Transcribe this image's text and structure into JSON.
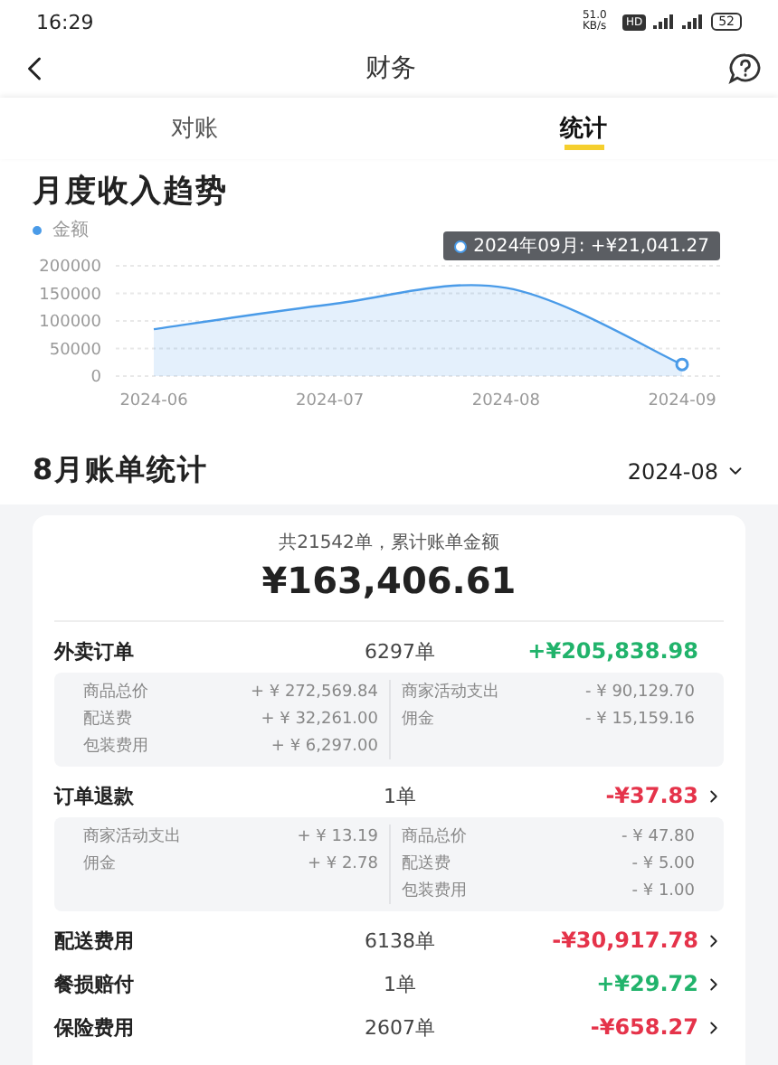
{
  "status_bar": {
    "time": "16:29",
    "speed": "51.0 KB/s",
    "hd": "HD",
    "battery": "52"
  },
  "nav": {
    "title": "财务"
  },
  "tabs": [
    {
      "label": "对账",
      "selected": false
    },
    {
      "label": "统计",
      "selected": true
    }
  ],
  "trend": {
    "title": "月度收入趋势",
    "tooltip": "2024年09月: +¥21,041.27",
    "chart_data": {
      "type": "area",
      "categories": [
        "2024-06",
        "2024-07",
        "2024-08",
        "2024-09"
      ],
      "series": [
        {
          "name": "金额",
          "color": "#4a9be8",
          "values": [
            85000,
            130000,
            160000,
            21041
          ]
        }
      ],
      "ylim": [
        0,
        200000
      ],
      "yticks": [
        0,
        50000,
        100000,
        150000,
        200000
      ],
      "grid": true
    }
  },
  "bill": {
    "title": "8月账单统计",
    "month": "2024-08",
    "caption": "共21542单，累计账单金额",
    "total": "¥163,406.61",
    "items": [
      {
        "name": "外卖订单",
        "count": "6297单",
        "amount": "+¥205,838.98",
        "color": "#21b36b",
        "link": false,
        "details": {
          "left": [
            {
              "label": "商品总价",
              "value": "+ ¥ 272,569.84"
            },
            {
              "label": "配送费",
              "value": "+ ¥ 32,261.00"
            },
            {
              "label": "包装费用",
              "value": "+ ¥ 6,297.00"
            }
          ],
          "right": [
            {
              "label": "商家活动支出",
              "value": "- ¥ 90,129.70"
            },
            {
              "label": "佣金",
              "value": "- ¥ 15,159.16"
            }
          ]
        }
      },
      {
        "name": "订单退款",
        "count": "1单",
        "amount": "-¥37.83",
        "color": "#e5334a",
        "link": true,
        "details": {
          "left": [
            {
              "label": "商家活动支出",
              "value": "+ ¥ 13.19"
            },
            {
              "label": "佣金",
              "value": "+ ¥ 2.78"
            }
          ],
          "right": [
            {
              "label": "商品总价",
              "value": "- ¥ 47.80"
            },
            {
              "label": "配送费",
              "value": "- ¥ 5.00"
            },
            {
              "label": "包装费用",
              "value": "- ¥ 1.00"
            }
          ]
        }
      },
      {
        "name": "配送费用",
        "count": "6138单",
        "amount": "-¥30,917.78",
        "color": "#e5334a",
        "link": true
      },
      {
        "name": "餐损赔付",
        "count": "1单",
        "amount": "+¥29.72",
        "color": "#21b36b",
        "link": true
      },
      {
        "name": "保险费用",
        "count": "2607单",
        "amount": "-¥658.27",
        "color": "#e5334a",
        "link": true
      }
    ]
  }
}
